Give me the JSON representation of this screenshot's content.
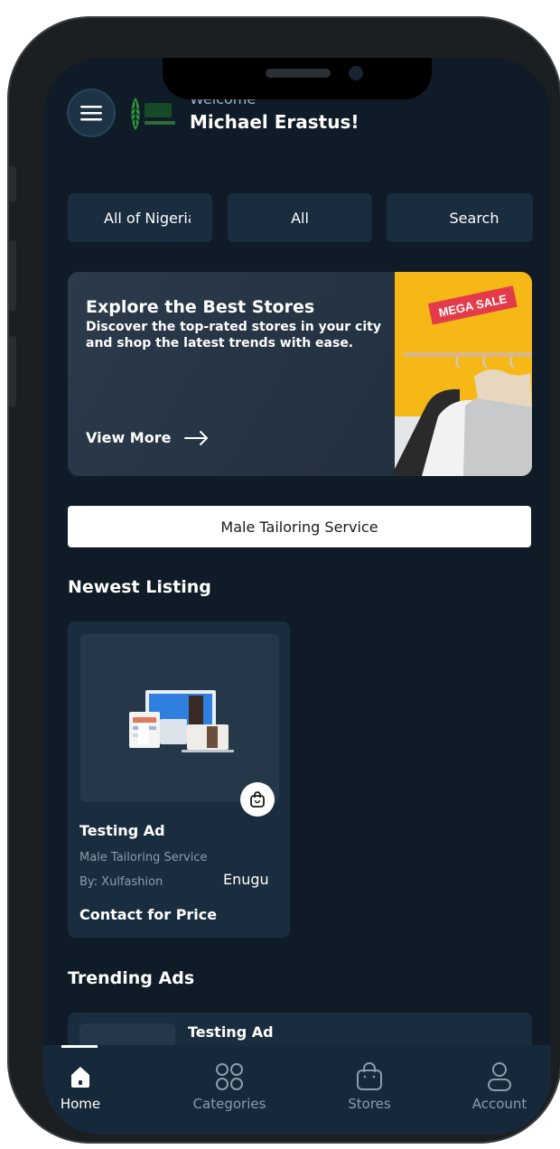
{
  "header": {
    "welcome": "Welcome",
    "user_name": "Michael Erastus!"
  },
  "filters": {
    "location": "All of Nigeria",
    "category": "All",
    "search": "Search"
  },
  "banner": {
    "title": "Explore the Best Stores",
    "description": "Discover the top-rated stores in your city and shop the latest trends with ease.",
    "cta": "View More",
    "sale_tag": "MEGA SALE"
  },
  "category_selector": {
    "label": "Male Tailoring Service"
  },
  "newest": {
    "heading": "Newest Listing",
    "items": [
      {
        "title": "Testing Ad",
        "category": "Male Tailoring Service",
        "by": "By: Xulfashion",
        "location": "Enugu",
        "price": "Contact for Price"
      }
    ]
  },
  "trending": {
    "heading": "Trending Ads",
    "items": [
      {
        "title": "Testing Ad"
      }
    ]
  },
  "bottom_nav": {
    "home": "Home",
    "categories": "Categories",
    "stores": "Stores",
    "account": "Account"
  },
  "colors": {
    "background": "#0f1b26",
    "card": "#1a2d3e",
    "accent_yellow": "#f6b817",
    "sale_red": "#e43b4b"
  }
}
